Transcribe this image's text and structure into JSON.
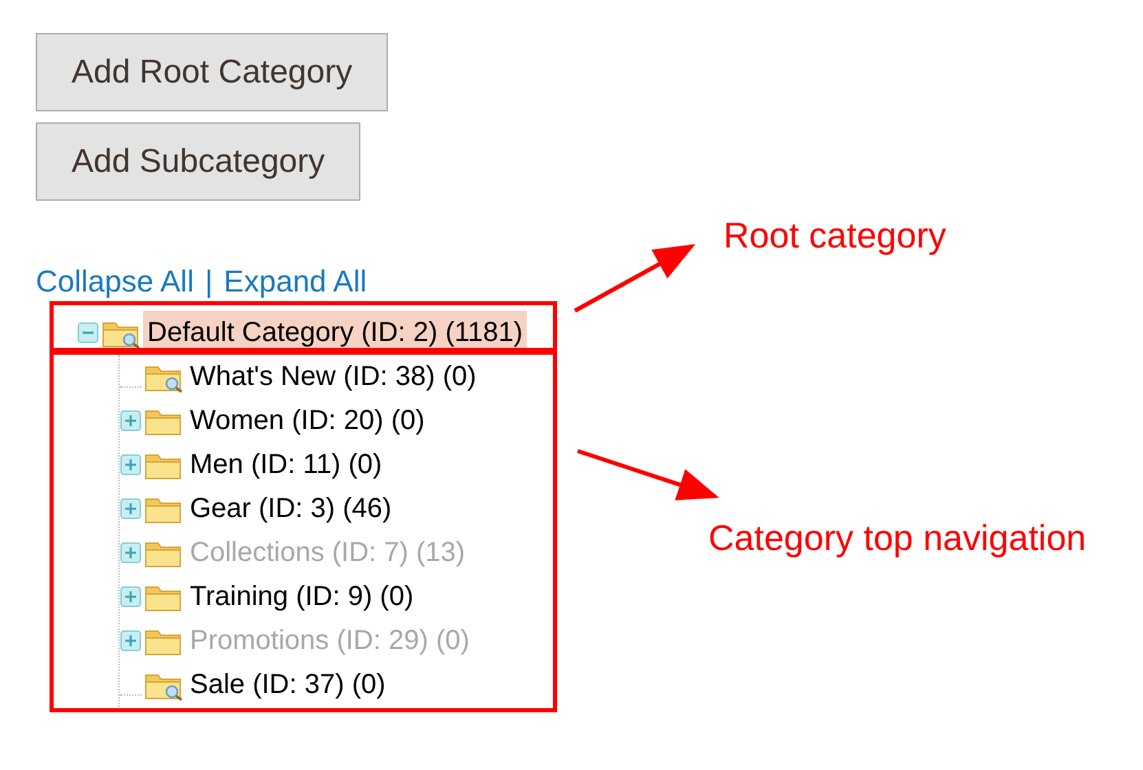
{
  "buttons": [
    "Add Root Category",
    "Add Subcategory"
  ],
  "tree_links": {
    "collapse": "Collapse All",
    "separator": "|",
    "expand": "Expand All"
  },
  "tree": [
    {
      "label": "Default Category (ID: 2) (1181)",
      "kind": "folder",
      "expanded": true,
      "selected": true,
      "disabled": false,
      "children": [
        {
          "label": "What's New (ID: 38) (0)",
          "kind": "leaf",
          "selected": false,
          "disabled": false
        },
        {
          "label": "Women (ID: 20) (0)",
          "kind": "folder",
          "expanded": false,
          "selected": false,
          "disabled": false
        },
        {
          "label": "Men (ID: 11) (0)",
          "kind": "folder",
          "expanded": false,
          "selected": false,
          "disabled": false
        },
        {
          "label": "Gear (ID: 3) (46)",
          "kind": "folder",
          "expanded": false,
          "selected": false,
          "disabled": false
        },
        {
          "label": "Collections (ID: 7) (13)",
          "kind": "folder",
          "expanded": false,
          "selected": false,
          "disabled": true
        },
        {
          "label": "Training (ID: 9) (0)",
          "kind": "folder",
          "expanded": false,
          "selected": false,
          "disabled": false
        },
        {
          "label": "Promotions (ID: 29) (0)",
          "kind": "folder",
          "expanded": false,
          "selected": false,
          "disabled": true
        },
        {
          "label": "Sale (ID: 37) (0)",
          "kind": "leaf",
          "selected": false,
          "disabled": false
        }
      ]
    }
  ],
  "annotations": [
    {
      "label": "Root category"
    },
    {
      "label": "Category top navigation"
    }
  ]
}
